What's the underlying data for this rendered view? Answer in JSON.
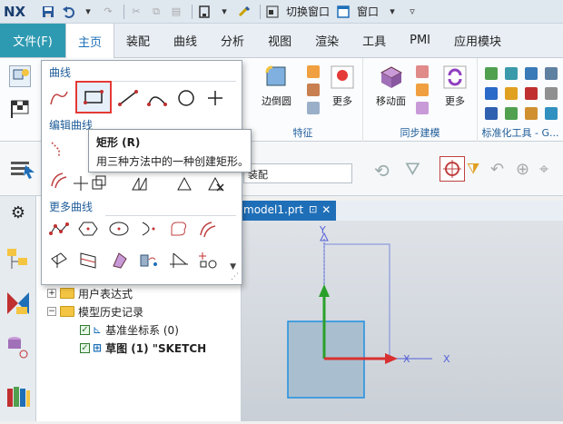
{
  "app": {
    "logo": "NX"
  },
  "quick_access": {
    "switch_window_label": "切换窗口",
    "window_label": "窗口"
  },
  "tabs": [
    {
      "label": "文件(F)"
    },
    {
      "label": "主页"
    },
    {
      "label": "装配"
    },
    {
      "label": "曲线"
    },
    {
      "label": "分析"
    },
    {
      "label": "视图"
    },
    {
      "label": "渲染"
    },
    {
      "label": "工具"
    },
    {
      "label": "PMI"
    },
    {
      "label": "应用模块"
    }
  ],
  "ribbon": {
    "groups": [
      {
        "label": "特征"
      },
      {
        "label": "同步建模"
      },
      {
        "label": "标准化工具 - G..."
      }
    ],
    "buttons": {
      "edge_round": "边倒圆",
      "more_1": "更多",
      "move_face": "移动面",
      "more_2": "更多"
    }
  },
  "toolbar2": {
    "assembly_select": "装配"
  },
  "gallery": {
    "sections": [
      {
        "title": "曲线"
      },
      {
        "title": "编辑曲线"
      },
      {
        "title": "更多曲线"
      }
    ]
  },
  "tooltip": {
    "title": "矩形 (R)",
    "description": "用三种方法中的一种创建矩形。"
  },
  "graphics": {
    "tab_label": "model1.prt",
    "axes": {
      "x": "X",
      "y": "Y"
    }
  },
  "navigator": {
    "rows": [
      {
        "label": "用户表达式"
      },
      {
        "label": "模型历史记录"
      },
      {
        "label": "基准坐标系 (0)"
      },
      {
        "label": "草图 (1) \"SKETCH"
      }
    ]
  },
  "colors": {
    "file_tab": "#2e9ab1",
    "accent_blue": "#1f6fb8",
    "selection_red": "#e53935"
  }
}
